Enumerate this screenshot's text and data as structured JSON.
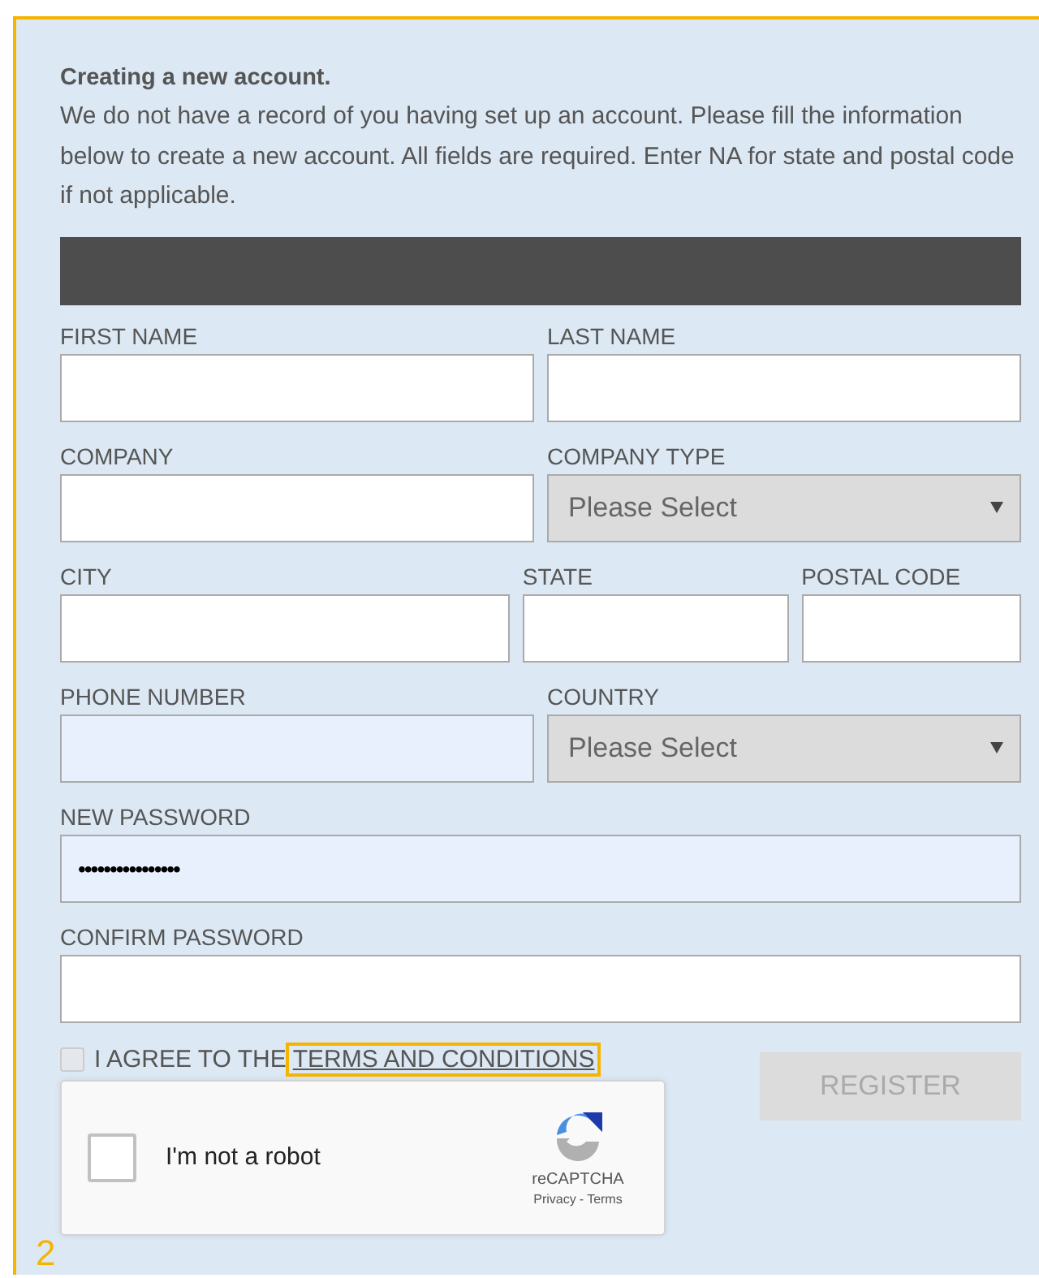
{
  "annotation": {
    "label": "2"
  },
  "intro": {
    "title": "Creating a new account.",
    "text": "We do not have a record of you having set up an account. Please fill the information below to create a new account. All fields are required. Enter NA for state and postal code if not applicable."
  },
  "rows": [
    [
      {
        "label": "FIRST NAME",
        "kind": "text"
      },
      {
        "label": "LAST NAME",
        "kind": "text"
      }
    ],
    [
      {
        "label": "COMPANY",
        "kind": "text"
      },
      {
        "label": "COMPANY TYPE",
        "kind": "select",
        "value": "Please Select"
      }
    ],
    [
      {
        "label": "CITY",
        "kind": "text"
      },
      {
        "label": "STATE",
        "kind": "text"
      },
      {
        "label": "POSTAL CODE",
        "kind": "text"
      }
    ],
    [
      {
        "label": "PHONE NUMBER",
        "kind": "text",
        "autofilled": true
      },
      {
        "label": "COUNTRY",
        "kind": "select",
        "value": "Please Select"
      }
    ],
    [
      {
        "label": "NEW PASSWORD",
        "kind": "password",
        "value": "••••••••••••••••",
        "autofilled": true
      }
    ],
    [
      {
        "label": "CONFIRM PASSWORD",
        "kind": "password"
      }
    ]
  ],
  "agree": {
    "checked": false,
    "text": "I AGREE TO THE",
    "link": "TERMS AND CONDITIONS",
    "highlighted": true
  },
  "register": {
    "label": "REGISTER",
    "disabled": true
  },
  "captcha": {
    "checked": false,
    "label": "I'm not a robot",
    "brand": "reCAPTCHA",
    "privacy": "Privacy",
    "separator": "-",
    "terms": "Terms"
  }
}
